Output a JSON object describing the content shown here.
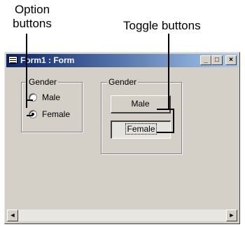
{
  "callouts": {
    "option_line1": "Option",
    "option_line2": "buttons",
    "toggle": "Toggle buttons"
  },
  "window": {
    "title": "Form1 : Form",
    "icon": "form-icon",
    "min_glyph": "_",
    "max_glyph": "□",
    "close_glyph": "×"
  },
  "option_group": {
    "label": "Gender",
    "options": [
      {
        "label": "Male",
        "checked": false
      },
      {
        "label": "Female",
        "checked": true
      }
    ]
  },
  "toggle_group": {
    "label": "Gender",
    "buttons": [
      {
        "label": "Male",
        "pressed": false
      },
      {
        "label": "Female",
        "pressed": true
      }
    ]
  },
  "scrollbar": {
    "left_glyph": "◄",
    "right_glyph": "►"
  }
}
